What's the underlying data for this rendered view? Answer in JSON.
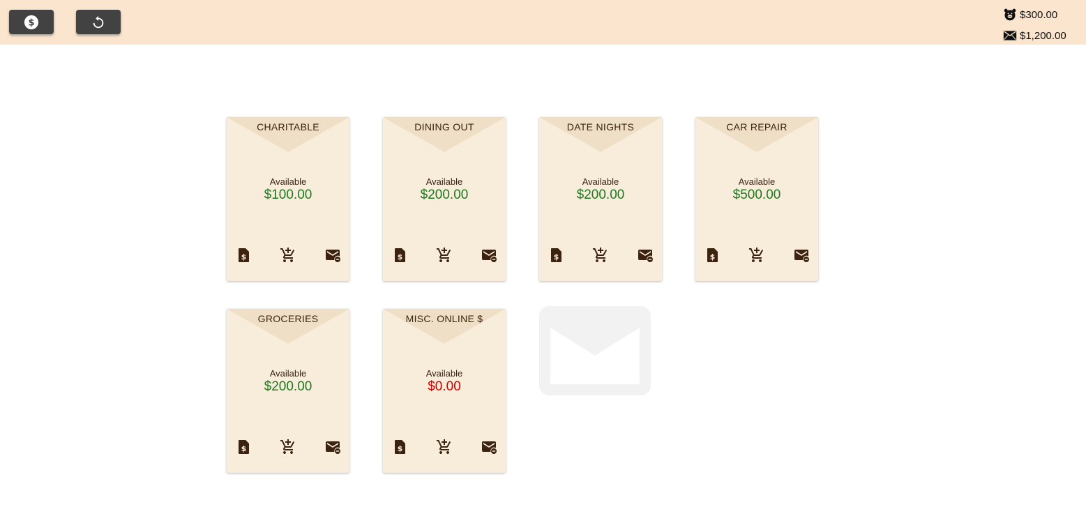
{
  "toolbar": {
    "income_button_icon": "dollar-circle-icon",
    "refresh_button_icon": "refresh-icon"
  },
  "totals": {
    "savings": {
      "icon": "piggy-bank-icon",
      "value": "$300.00"
    },
    "envelopes": {
      "icon": "envelope-icon",
      "value": "$1,200.00"
    }
  },
  "envelopes": [
    {
      "name": "CHARITABLE",
      "available_label": "Available",
      "amount": "$100.00",
      "status": "positive"
    },
    {
      "name": "DINING OUT",
      "available_label": "Available",
      "amount": "$200.00",
      "status": "positive"
    },
    {
      "name": "DATE NIGHTS",
      "available_label": "Available",
      "amount": "$200.00",
      "status": "positive"
    },
    {
      "name": "CAR REPAIR",
      "available_label": "Available",
      "amount": "$500.00",
      "status": "positive"
    },
    {
      "name": "GROCERIES",
      "available_label": "Available",
      "amount": "$200.00",
      "status": "positive"
    },
    {
      "name": "MISC. ONLINE $",
      "available_label": "Available",
      "amount": "$0.00",
      "status": "zero"
    }
  ],
  "envelope_actions": [
    "bill-document-icon",
    "add-to-cart-icon",
    "mail-remove-icon"
  ],
  "add_envelope": {
    "icon": "envelope-outline-icon"
  },
  "colors": {
    "topbar": "#fbe5cf",
    "card": "#f8ecdb",
    "flap": "#efdfc6",
    "positive": "#1f7a1f",
    "zero": "#d40000",
    "ink": "#3b2310"
  }
}
